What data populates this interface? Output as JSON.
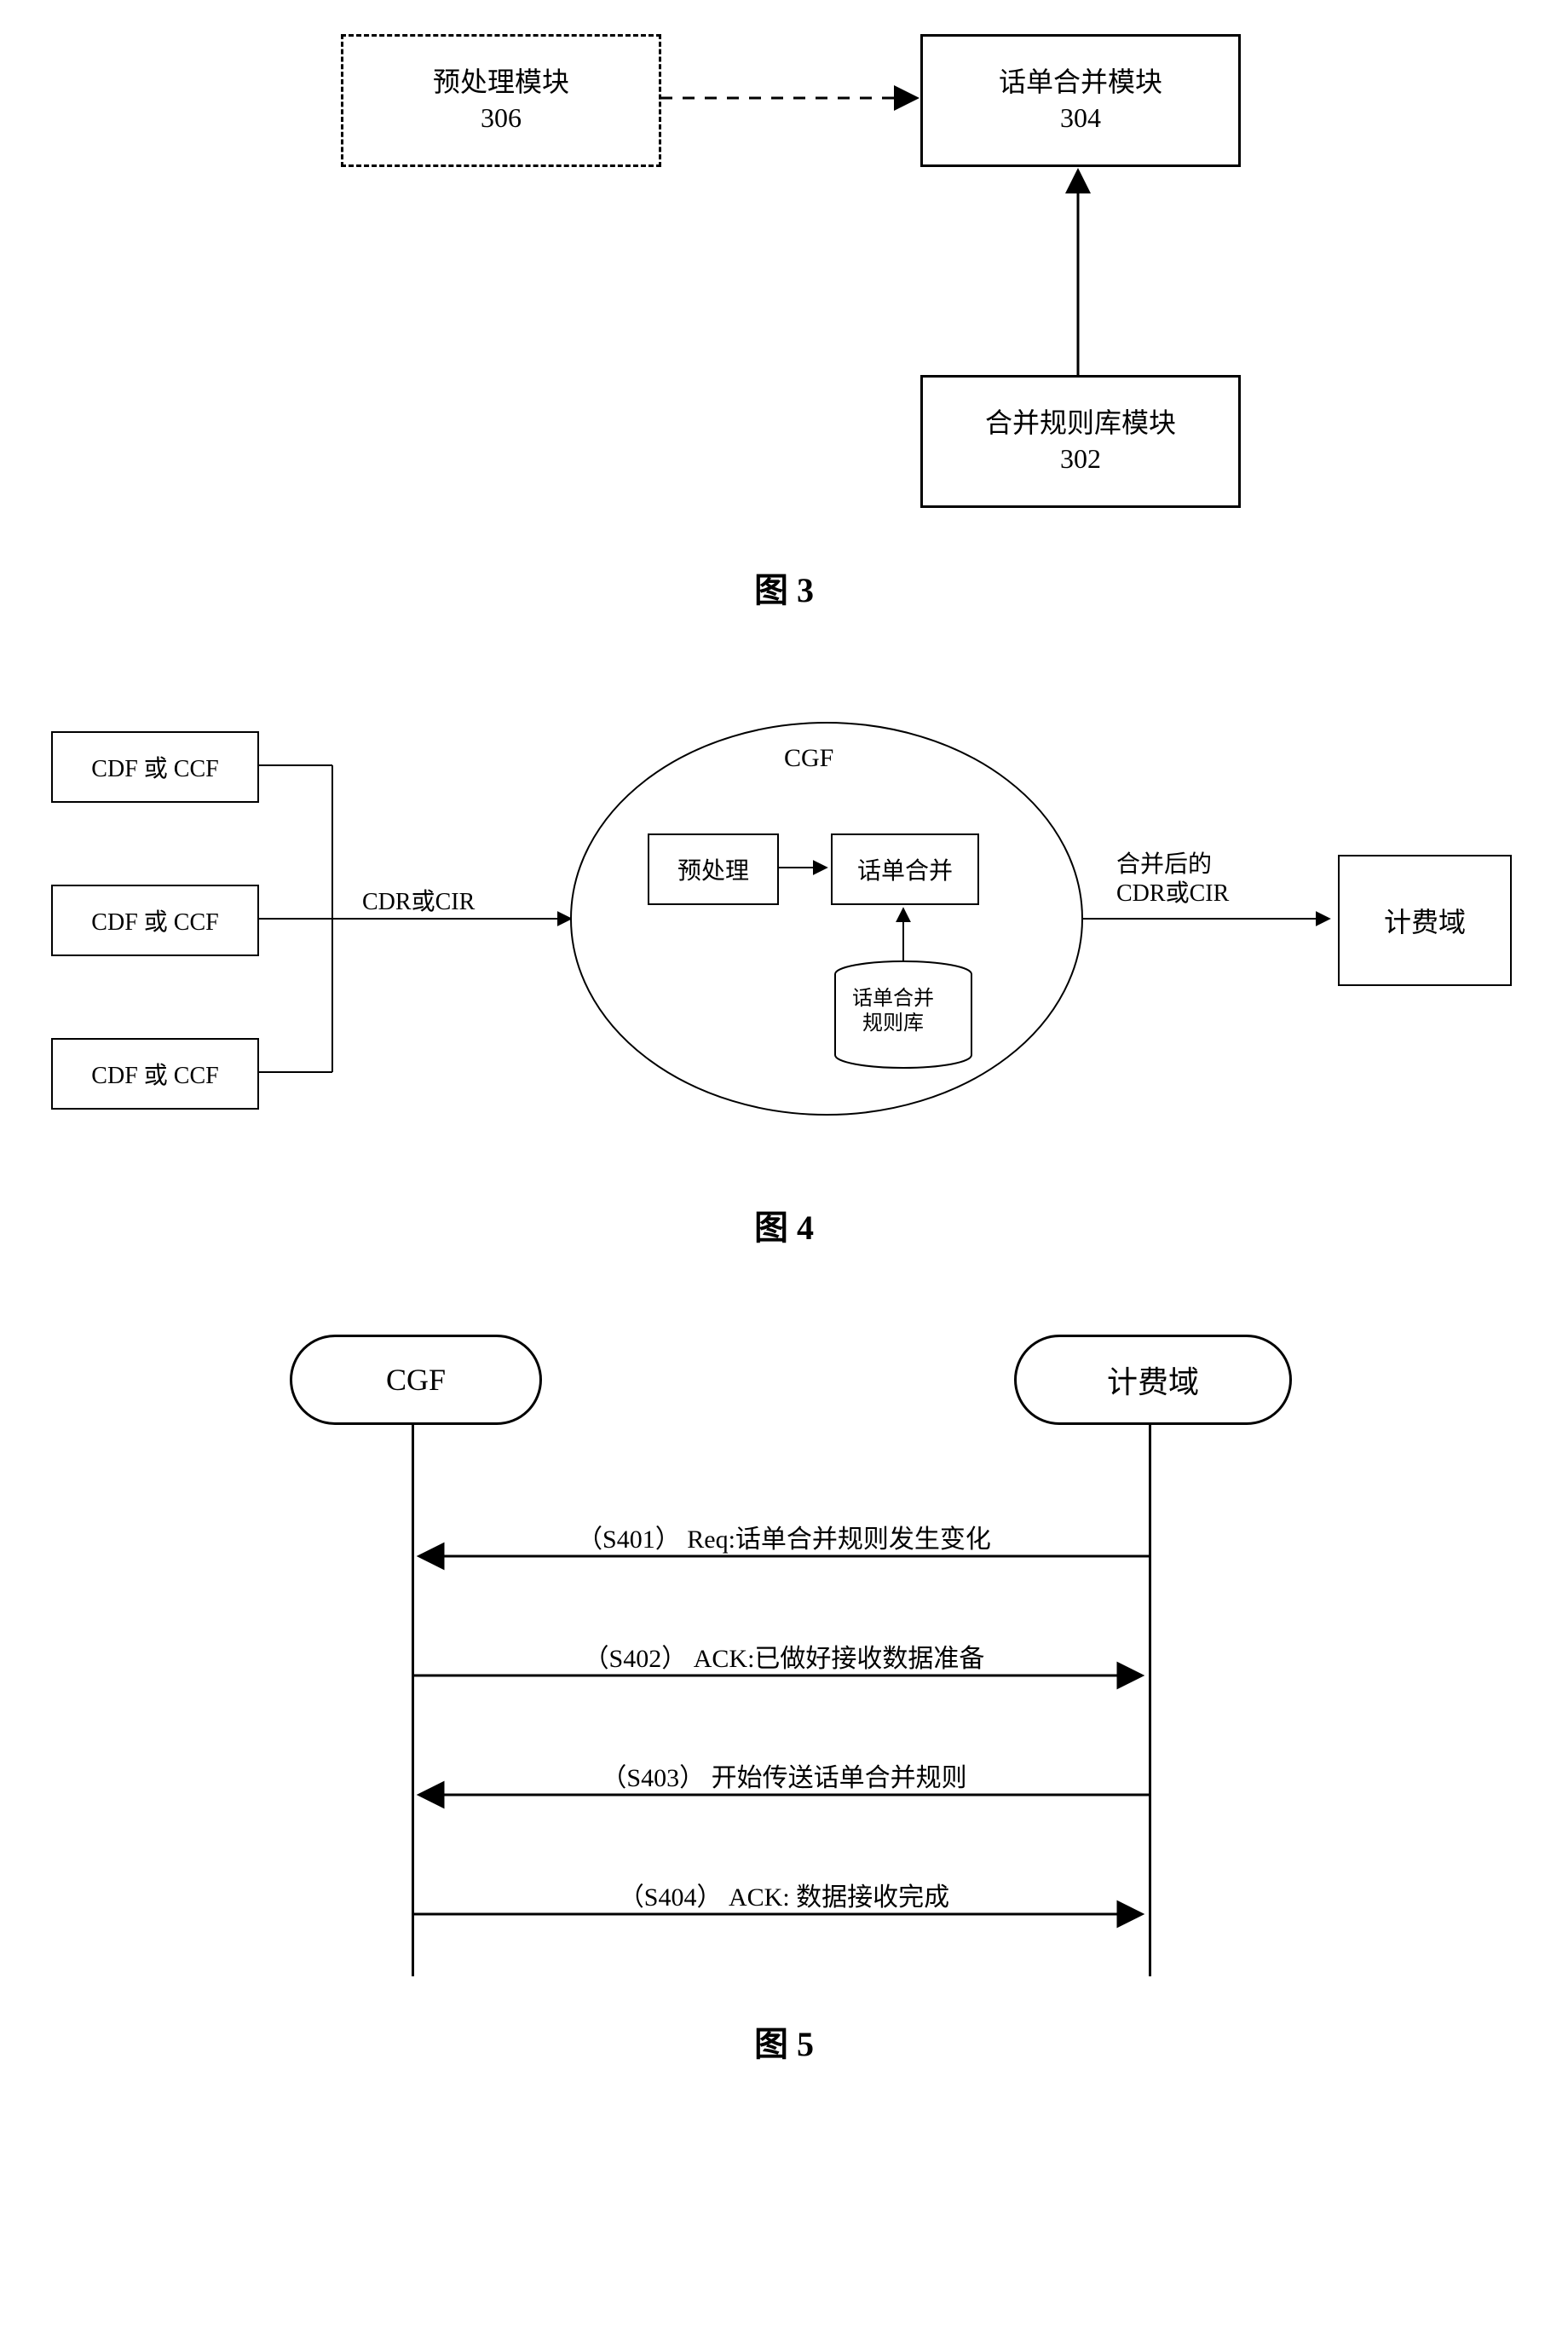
{
  "fig3": {
    "caption": "图 3",
    "preproc": {
      "label": "预处理模块",
      "num": "306"
    },
    "merge": {
      "label": "话单合并模块",
      "num": "304"
    },
    "rules": {
      "label": "合并规则库模块",
      "num": "302"
    }
  },
  "fig4": {
    "caption": "图 4",
    "sources": [
      "CDF 或 CCF",
      "CDF 或 CCF",
      "CDF 或 CCF"
    ],
    "arrow_in": "CDR或CIR",
    "cgf_title": "CGF",
    "preproc": "预处理",
    "merge": "话单合并",
    "rules_db_l1": "话单合并",
    "rules_db_l2": "规则库",
    "arrow_out_l1": "合并后的",
    "arrow_out_l2": "CDR或CIR",
    "billing": "计费域"
  },
  "fig5": {
    "caption": "图 5",
    "left": "CGF",
    "right": "计费域",
    "messages": [
      {
        "text": "（S401） Req:话单合并规则发生变化",
        "dir": "left"
      },
      {
        "text": "（S402） ACK:已做好接收数据准备",
        "dir": "right"
      },
      {
        "text": "（S403） 开始传送话单合并规则",
        "dir": "left"
      },
      {
        "text": "（S404） ACK:   数据接收完成",
        "dir": "right"
      }
    ]
  }
}
